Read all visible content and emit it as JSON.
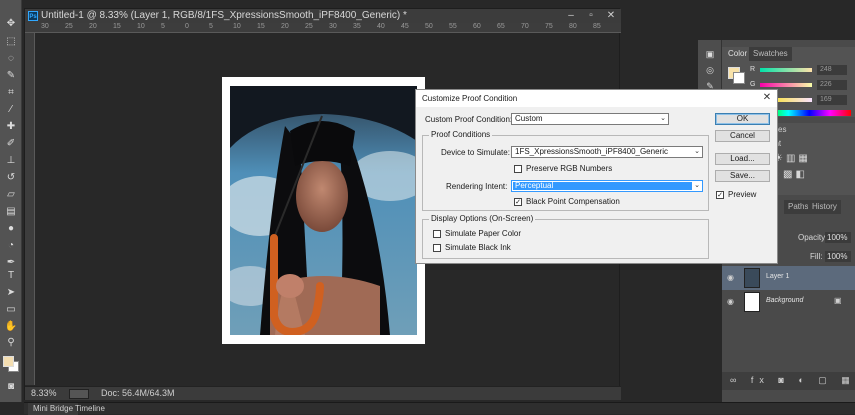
{
  "document": {
    "title": "Untitled-1 @ 8.33% (Layer 1, RGB/8/1FS_XpressionsSmooth_iPF8400_Generic) *",
    "zoom": "8.33%",
    "doc_size": "Doc: 56.4M/64.3M",
    "ruler_ticks": [
      "30",
      "25",
      "20",
      "15",
      "10",
      "5",
      "0",
      "5",
      "10",
      "15",
      "20",
      "25",
      "30",
      "35",
      "40",
      "45",
      "50",
      "55",
      "60",
      "65",
      "70",
      "75",
      "80",
      "85"
    ]
  },
  "bottom_tabs": [
    "Mini Bridge",
    "Timeline"
  ],
  "color_panel": {
    "tabs": [
      "Color",
      "Swatches"
    ],
    "channels": [
      {
        "label": "R",
        "value": "248"
      },
      {
        "label": "G",
        "value": "226"
      },
      {
        "label": "B",
        "value": "169"
      }
    ],
    "foreground_color": "#f8e2a9"
  },
  "right_panels": {
    "styles_tab": "tyles",
    "adjustments_tab": "ent",
    "layers_tabs": [
      "Paths",
      "History"
    ],
    "opacity_label": "Opacity:",
    "opacity_value": "100%",
    "fill_label": "Fill:",
    "fill_value": "100%"
  },
  "layers": [
    {
      "name": "Layer 1",
      "selected": true
    },
    {
      "name": "Background",
      "selected": false
    }
  ],
  "dialog": {
    "title": "Customize Proof Condition",
    "custom_condition_label": "Custom Proof Condition:",
    "custom_condition_value": "Custom",
    "proof_conditions_title": "Proof Conditions",
    "device_label": "Device to Simulate:",
    "device_value": "1FS_XpressionsSmooth_iPF8400_Generic",
    "preserve_rgb_label": "Preserve RGB Numbers",
    "preserve_rgb_checked": false,
    "intent_label": "Rendering Intent:",
    "intent_value": "Perceptual",
    "black_point_label": "Black Point Compensation",
    "black_point_checked": true,
    "display_options_title": "Display Options (On-Screen)",
    "paper_color_label": "Simulate Paper Color",
    "paper_color_checked": false,
    "black_ink_label": "Simulate Black Ink",
    "black_ink_checked": false,
    "ok_label": "OK",
    "cancel_label": "Cancel",
    "load_label": "Load...",
    "save_label": "Save...",
    "preview_label": "Preview",
    "preview_checked": true
  }
}
